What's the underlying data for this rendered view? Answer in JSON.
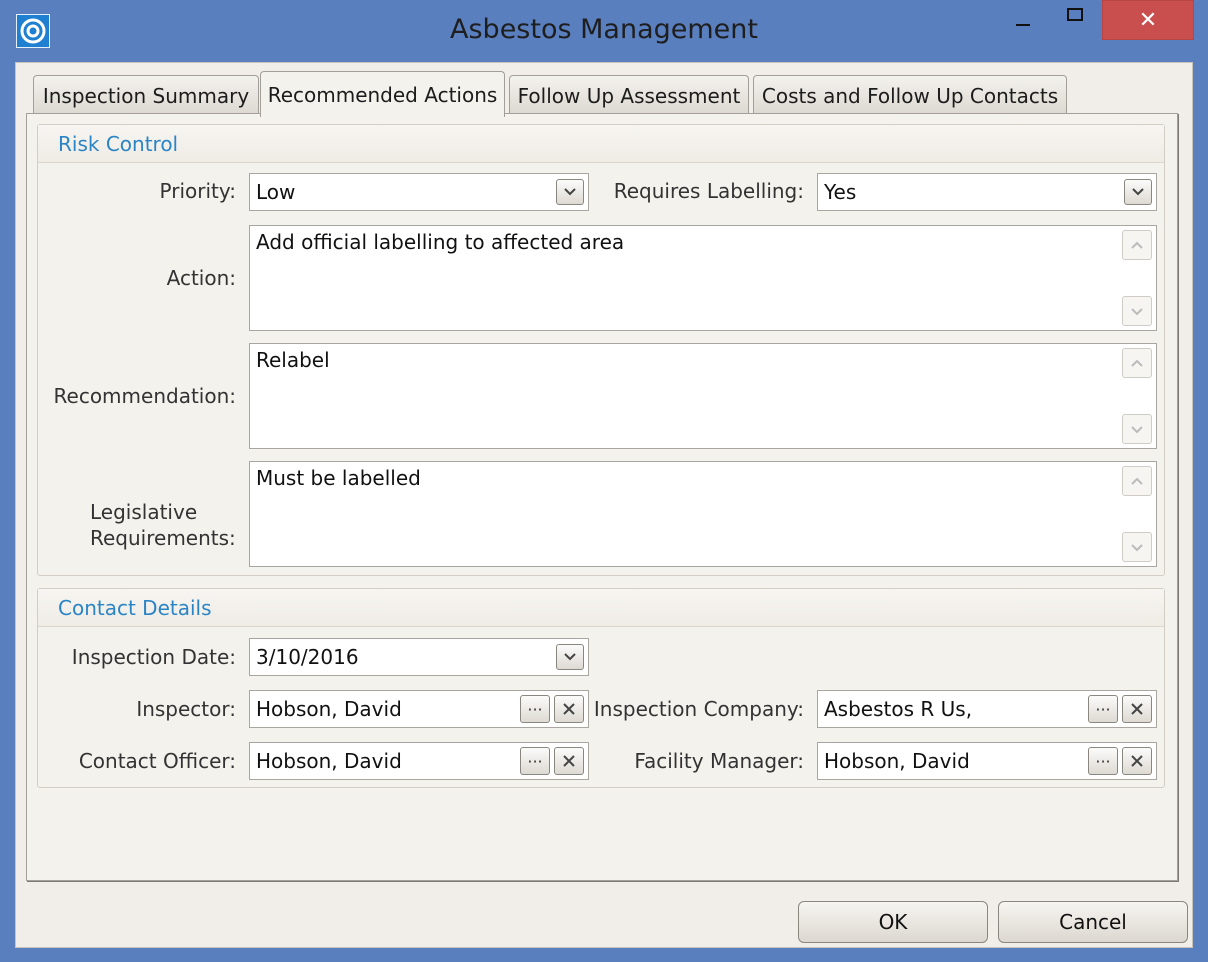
{
  "window": {
    "title": "Asbestos Management",
    "close_glyph": "✕"
  },
  "tabs": [
    {
      "label": "Inspection Summary",
      "active": false
    },
    {
      "label": "Recommended Actions",
      "active": true
    },
    {
      "label": "Follow Up Assessment",
      "active": false
    },
    {
      "label": "Costs and Follow Up Contacts",
      "active": false
    }
  ],
  "risk_control": {
    "header": "Risk Control",
    "priority_label": "Priority:",
    "priority_value": "Low",
    "requires_labelling_label": "Requires Labelling:",
    "requires_labelling_value": "Yes",
    "action_label": "Action:",
    "action_value": "Add official labelling to affected area",
    "recommendation_label": "Recommendation:",
    "recommendation_value": "Relabel",
    "legislative_label_line1": "Legislative",
    "legislative_label_line2": "Requirements:",
    "legislative_value": "Must be labelled"
  },
  "contact_details": {
    "header": "Contact Details",
    "inspection_date_label": "Inspection Date:",
    "inspection_date_value": "3/10/2016",
    "inspector_label": "Inspector:",
    "inspector_value": "Hobson, David",
    "inspection_company_label": "Inspection Company:",
    "inspection_company_value": "Asbestos R Us,",
    "contact_officer_label": "Contact Officer:",
    "contact_officer_value": "Hobson, David",
    "facility_manager_label": "Facility Manager:",
    "facility_manager_value": "Hobson, David",
    "lookup_glyph": "···"
  },
  "buttons": {
    "ok": "OK",
    "cancel": "Cancel"
  },
  "colors": {
    "title_bar": "#5a7fbf",
    "close_button": "#c94f4f",
    "group_header_text": "#2b84c5"
  }
}
